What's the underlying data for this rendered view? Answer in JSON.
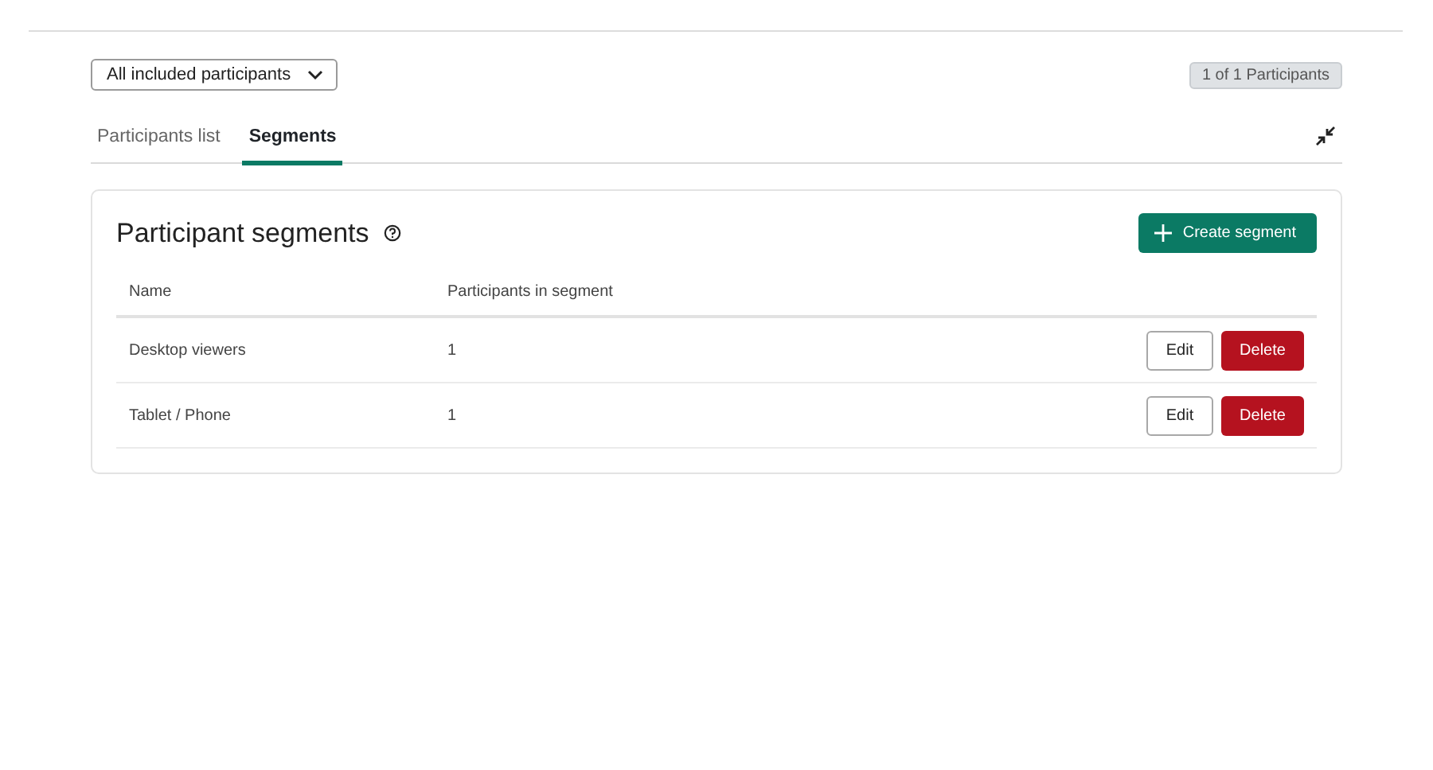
{
  "filter": {
    "label": "All included participants"
  },
  "count_badge": "1 of 1 Participants",
  "tabs": [
    {
      "label": "Participants list",
      "selected": false
    },
    {
      "label": "Segments",
      "selected": true
    }
  ],
  "card": {
    "title": "Participant segments",
    "create_button": "Create segment",
    "columns": [
      "Name",
      "Participants in segment"
    ],
    "rows": [
      {
        "name": "Desktop viewers",
        "count": "1",
        "edit": "Edit",
        "delete": "Delete"
      },
      {
        "name": "Tablet / Phone",
        "count": "1",
        "edit": "Edit",
        "delete": "Delete"
      }
    ]
  }
}
